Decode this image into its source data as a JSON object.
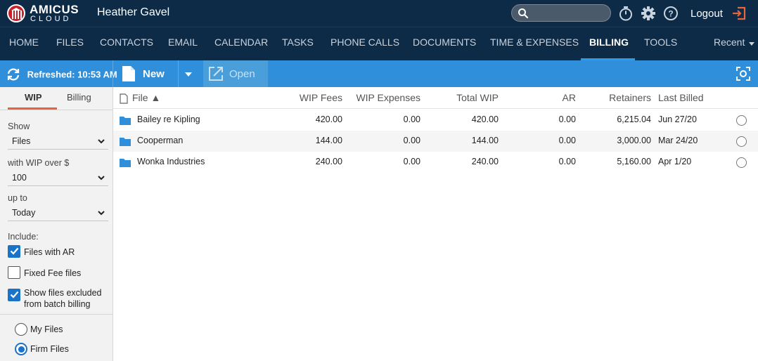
{
  "header": {
    "logo_brand": "AMICUS",
    "logo_sub": "CLOUD",
    "user_name": "Heather Gavel",
    "search_placeholder": "",
    "logout_label": "Logout",
    "icons": [
      "search-icon",
      "stopwatch-icon",
      "gear-icon",
      "help-icon",
      "logout-icon"
    ]
  },
  "nav": {
    "items": [
      {
        "label": "HOME"
      },
      {
        "label": "FILES"
      },
      {
        "label": "CONTACTS"
      },
      {
        "label": "EMAIL"
      },
      {
        "label": "CALENDAR"
      },
      {
        "label": "TASKS"
      },
      {
        "label": "PHONE CALLS"
      },
      {
        "label": "DOCUMENTS"
      },
      {
        "label": "TIME & EXPENSES"
      },
      {
        "label": "BILLING"
      },
      {
        "label": "TOOLS"
      }
    ],
    "active": "BILLING",
    "recent_label": "Recent"
  },
  "toolbar": {
    "refreshed_label": "Refreshed: 10:53 AM",
    "new_label": "New",
    "open_label": "Open"
  },
  "sidepanel": {
    "tabs": [
      {
        "label": "WIP"
      },
      {
        "label": "Billing"
      }
    ],
    "active_tab": "WIP",
    "show_label": "Show",
    "show_value": "Files",
    "wip_over_label": "with WIP over $",
    "wip_over_value": "100",
    "up_to_label": "up to",
    "up_to_value": "Today",
    "include_label": "Include:",
    "checkboxes": [
      {
        "label": "Files with AR",
        "checked": true
      },
      {
        "label": "Fixed Fee files",
        "checked": false
      },
      {
        "label_line1": "Show files excluded",
        "label_line2": "from batch billing",
        "checked": true
      }
    ],
    "radios": [
      {
        "label": "My Files",
        "selected": false
      },
      {
        "label": "Firm Files",
        "selected": true
      }
    ]
  },
  "grid": {
    "columns": {
      "file": "File ▲",
      "wip_fees": "WIP Fees",
      "wip_expenses": "WIP Expenses",
      "total_wip": "Total WIP",
      "ar": "AR",
      "retainers": "Retainers",
      "last_billed": "Last Billed"
    },
    "rows": [
      {
        "file": "Bailey re Kipling",
        "wip_fees": "420.00",
        "wip_expenses": "0.00",
        "total_wip": "420.00",
        "ar": "0.00",
        "retainers": "6,215.04",
        "last_billed": "Jun 27/20"
      },
      {
        "file": "Cooperman",
        "wip_fees": "144.00",
        "wip_expenses": "0.00",
        "total_wip": "144.00",
        "ar": "0.00",
        "retainers": "3,000.00",
        "last_billed": "Mar 24/20"
      },
      {
        "file": "Wonka Industries",
        "wip_fees": "240.00",
        "wip_expenses": "0.00",
        "total_wip": "240.00",
        "ar": "0.00",
        "retainers": "5,160.00",
        "last_billed": "Apr 1/20"
      }
    ]
  },
  "colors": {
    "header_bg": "#0d2a47",
    "toolbar_bg": "#2f8fda",
    "nav_active_underline": "#2e9be6",
    "tab_active_underline": "#e8643a",
    "checkbox_on": "#1a73c8",
    "logout_icon": "#e8643a",
    "folder_icon": "#2f8fda"
  }
}
